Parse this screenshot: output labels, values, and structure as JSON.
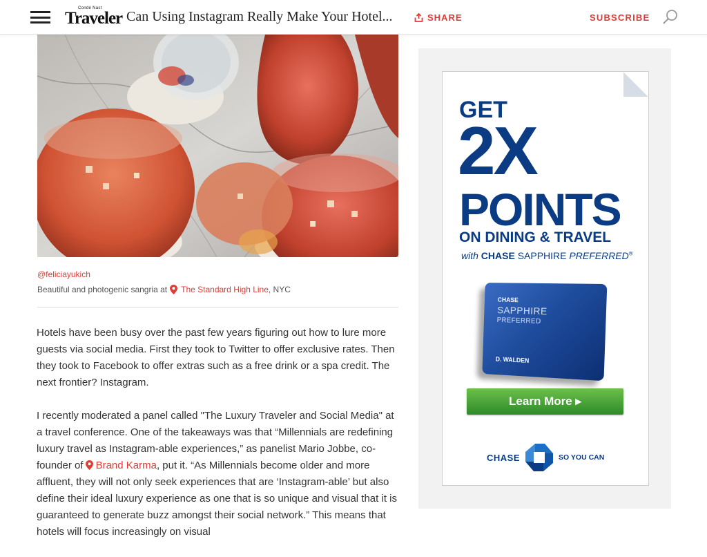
{
  "header": {
    "logo_small": "Condé Nast",
    "logo_big": "Traveler",
    "headline": "Can Using Instagram Really Make Your Hotel...",
    "share_label": "SHARE",
    "subscribe_label": "SUBSCRIBE"
  },
  "photo": {
    "credit": "@feliciayukich",
    "caption_prefix": "Beautiful and photogenic sangria at",
    "caption_location": "The Standard High Line",
    "caption_suffix": ", NYC"
  },
  "article": {
    "p1": "Hotels have been busy over the past few years figuring out how to lure more guests via social media. First they took to Twitter to offer exclusive rates. Then they took to Facebook to offer extras such as a free drink or a spa credit. The next frontier? Instagram.",
    "p2_before": "I recently moderated a panel called \"The Luxury Traveler and Social Media\" at a travel conference. One of the takeaways was that “Millennials are redefining luxury travel as Instagram-able experiences,” as panelist Mario Jobbe, co-founder of",
    "p2_link": "Brand Karma",
    "p2_after": ", put it. “As Millennials become older and more affluent, they will not only seek experiences that are ‘Instagram-able’ but also define their ideal luxury experience as one that is so unique and visual that it is guaranteed to generate buzz amongst their social network.” This means that hotels will focus increasingly on visual"
  },
  "ad": {
    "get": "GET",
    "two_x": "2X",
    "points": "POINTS",
    "dining": "ON DINING & TRAVEL",
    "with": "with",
    "chase": "CHASE",
    "sapphire": "SAPPHIRE",
    "preferred": "PREFERRED",
    "reg": "®",
    "card_brand": "CHASE",
    "card_line1": "SAPPHIRE",
    "card_line2": "PREFERRED",
    "card_name": "D. WALDEN",
    "learn_more": "Learn More ▸",
    "footer_brand": "CHASE",
    "footer_tagline": "SO YOU CAN",
    "colors": {
      "navy": "#0b3b83",
      "green": "#3a9b32",
      "accent": "#e13b35"
    }
  }
}
